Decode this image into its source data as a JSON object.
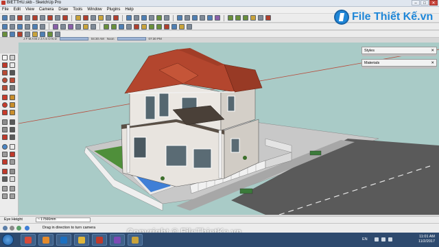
{
  "window": {
    "title": "BIETTHU.skb - SketchUp Pro",
    "controls": {
      "minimize": "–",
      "maximize": "□",
      "close": "✕"
    }
  },
  "menu": [
    "File",
    "Edit",
    "View",
    "Camera",
    "Draw",
    "Tools",
    "Window",
    "Plugins",
    "Help"
  ],
  "shadow_settings": {
    "months": "J F M A M J J A S O N D",
    "time_start": "04:30 AM",
    "time_mid": "Noon",
    "time_end": "07:30 PM"
  },
  "logo": {
    "text": "File Thiết Kế.vn",
    "color": "#1f87d8"
  },
  "panels": {
    "styles": "Styles",
    "materials": "Materials",
    "close_glyph": "✕"
  },
  "measurements": {
    "label": "Eye Height",
    "value": "~ 17566mm"
  },
  "status": {
    "hint": "Drag in direction to turn camera"
  },
  "watermark": "Copyright © FileThietKe.vn",
  "taskbar": {
    "language": "EN",
    "time": "11:01 AM",
    "date": "11/2/2017",
    "apps": [
      "chrome-icon",
      "firefox-icon",
      "photoshop-icon",
      "explorer-icon",
      "sketchup-icon",
      "media-icon",
      "folder-icon"
    ]
  },
  "colors": {
    "sky": "#a9cbc7",
    "roof": "#b3462e",
    "wall": "#e8e4df",
    "pool": "#3f7fd6",
    "grass": "#4f8f3a",
    "road": "#5a5a5a"
  }
}
